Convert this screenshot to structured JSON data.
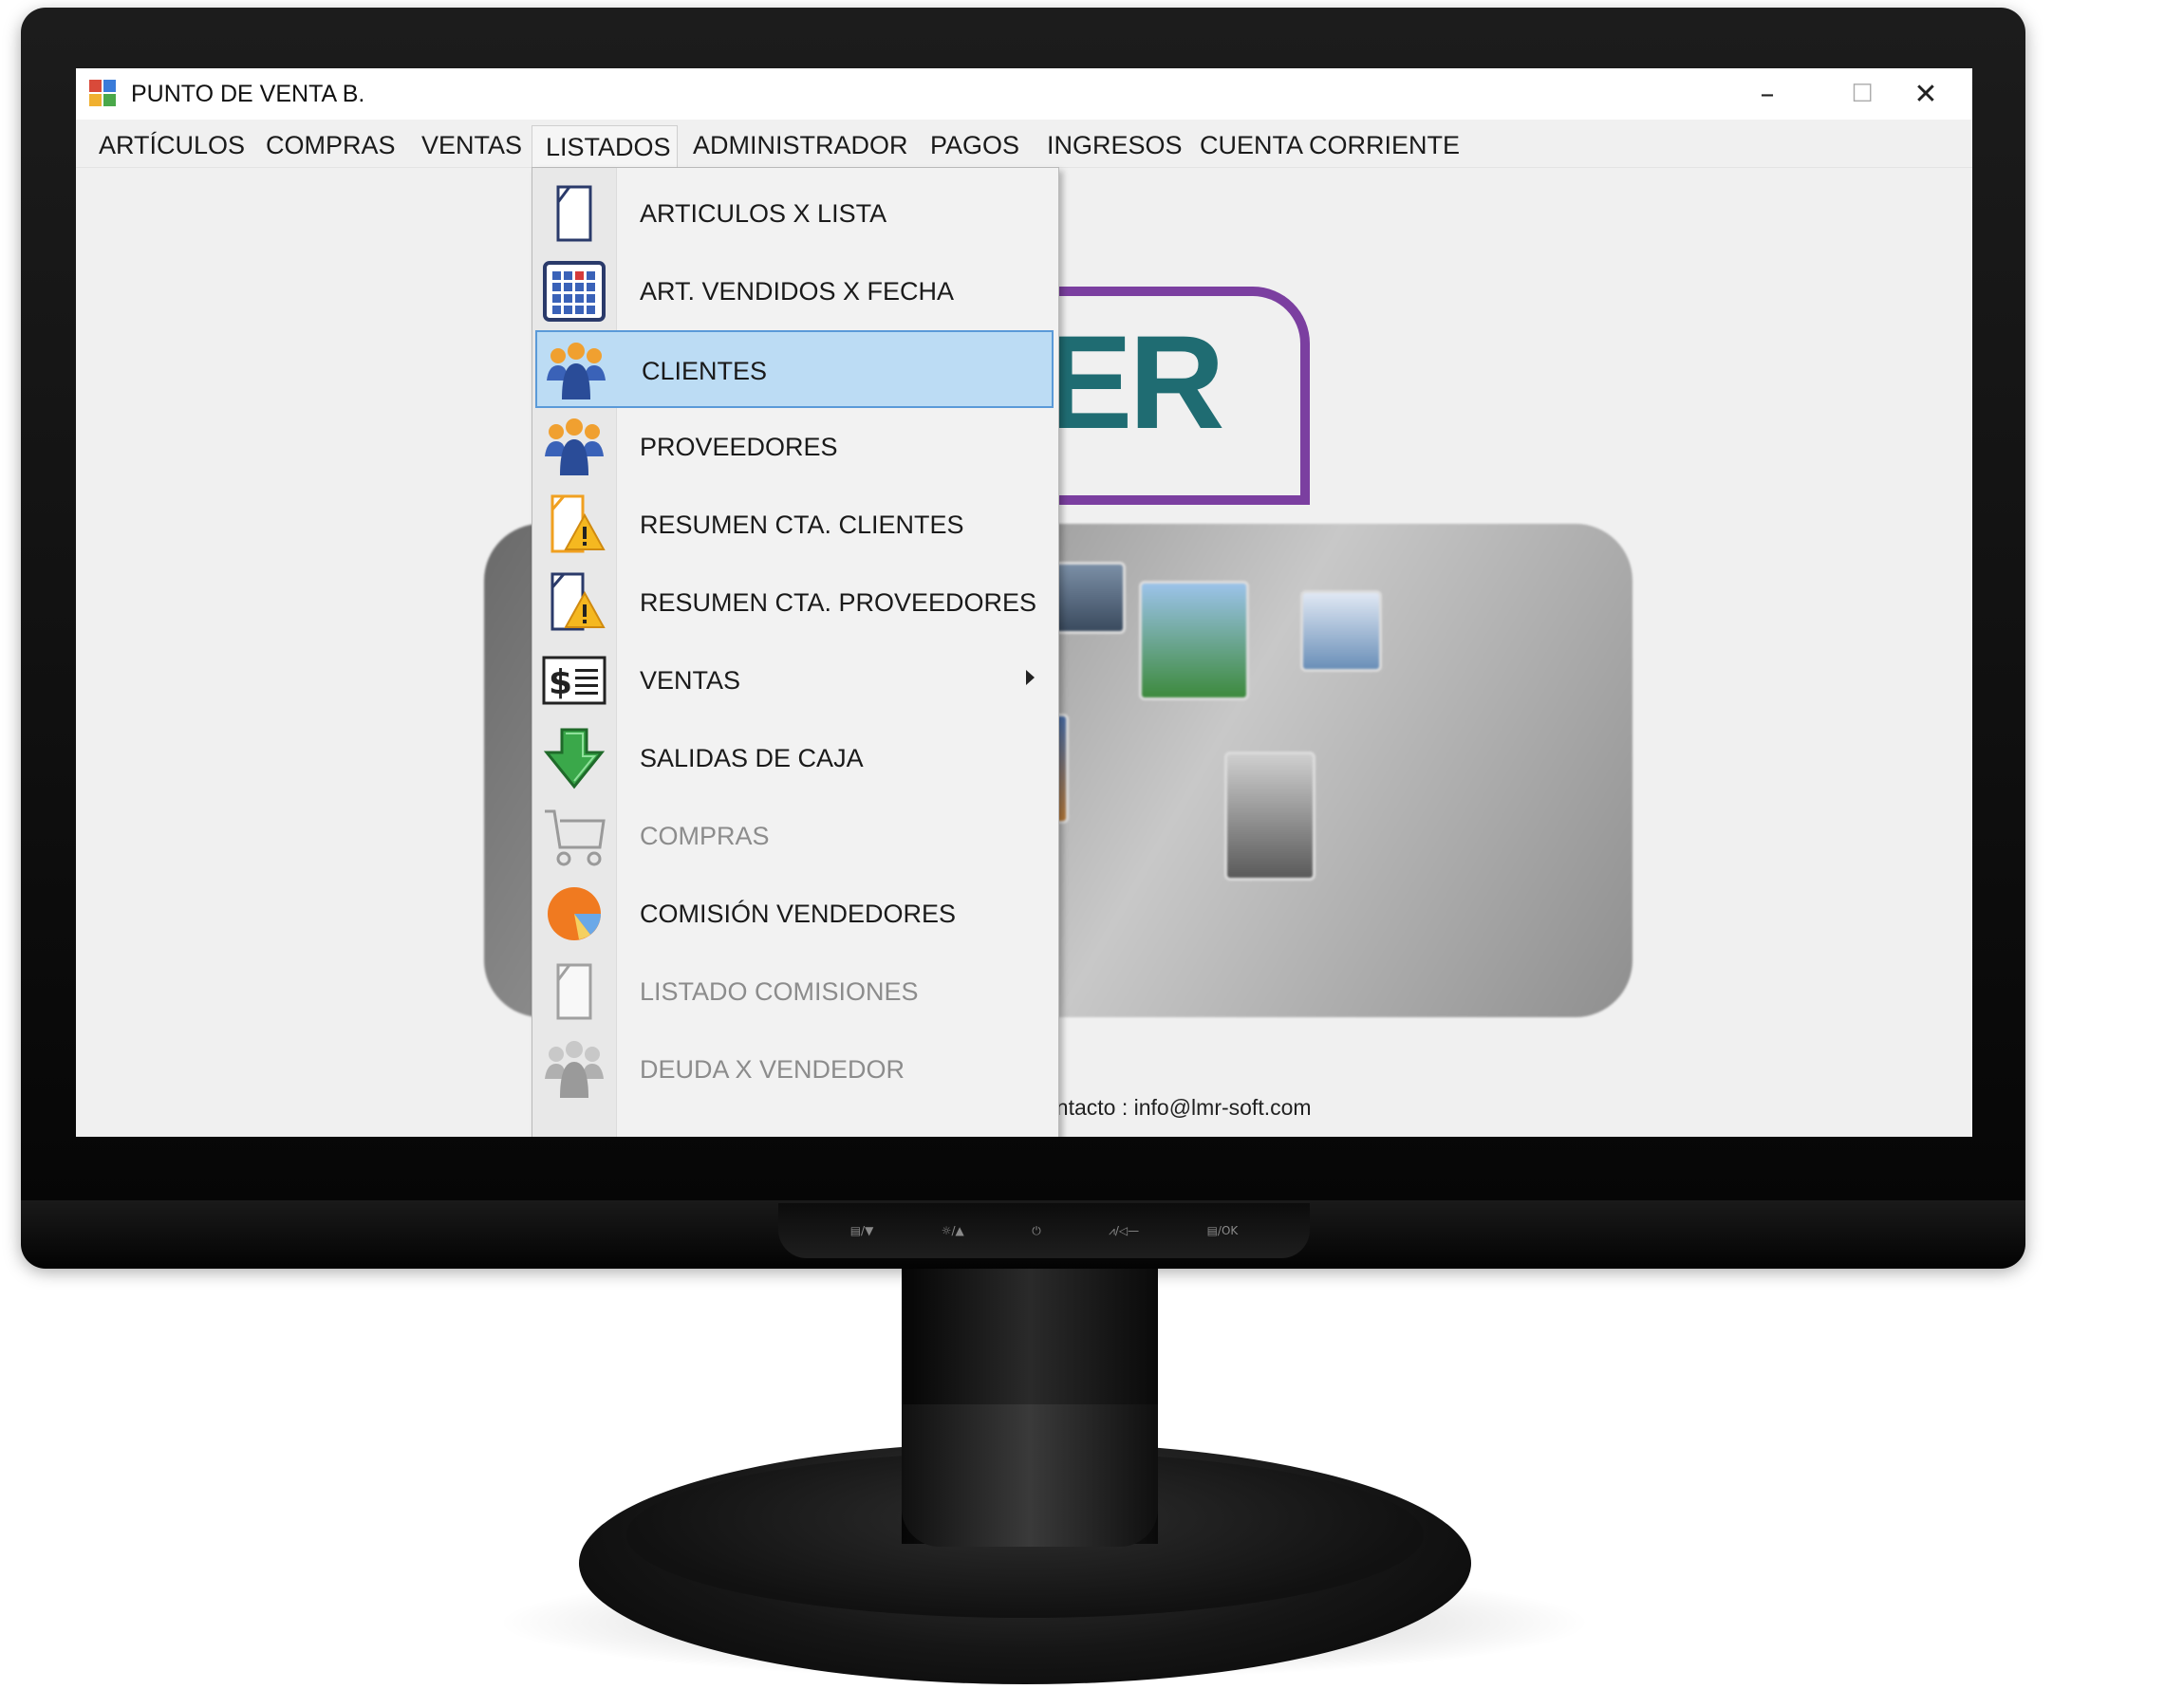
{
  "window": {
    "title": "PUNTO DE VENTA B.",
    "controls": {
      "minimize": "–",
      "maximize": "☐",
      "close": "✕"
    }
  },
  "menubar": {
    "items": [
      {
        "label": "ARTÍCULOS"
      },
      {
        "label": "COMPRAS"
      },
      {
        "label": "VENTAS"
      },
      {
        "label": "LISTADOS"
      },
      {
        "label": "ADMINISTRADOR"
      },
      {
        "label": "PAGOS"
      },
      {
        "label": "INGRESOS"
      },
      {
        "label": "CUENTA CORRIENTE"
      }
    ],
    "open_menu": "LISTADOS"
  },
  "dropdown": {
    "items": [
      {
        "label": "ARTICULOS X LISTA",
        "icon": "document-icon",
        "enabled": true
      },
      {
        "label": "ART. VENDIDOS X FECHA",
        "icon": "calendar-grid-icon",
        "enabled": true
      },
      {
        "label": "CLIENTES",
        "icon": "people-group-icon",
        "enabled": true,
        "selected": true
      },
      {
        "label": "PROVEEDORES",
        "icon": "people-group-icon",
        "enabled": true
      },
      {
        "label": "RESUMEN CTA. CLIENTES",
        "icon": "warning-document-icon",
        "enabled": true
      },
      {
        "label": "RESUMEN CTA. PROVEEDORES",
        "icon": "warning-document-icon",
        "enabled": true
      },
      {
        "label": "VENTAS",
        "icon": "dollar-list-icon",
        "enabled": true,
        "has_submenu": true
      },
      {
        "label": "SALIDAS DE CAJA",
        "icon": "down-arrow-icon",
        "enabled": true
      },
      {
        "label": "COMPRAS",
        "icon": "cart-icon",
        "enabled": false
      },
      {
        "label": "COMISIÓN VENDEDORES",
        "icon": "pie-chart-icon",
        "enabled": true
      },
      {
        "label": "LISTADO COMISIONES",
        "icon": "document-icon",
        "enabled": false
      },
      {
        "label": "DEUDA X VENDEDOR",
        "icon": "people-group-icon",
        "enabled": false
      }
    ]
  },
  "background": {
    "logo_text": "ER",
    "contact": "ontacto : info@lmr-soft.com"
  },
  "monitor": {
    "controls": [
      "▤/▼",
      "☼/▲",
      "⏻",
      "⩘/◁—",
      "▤/OK"
    ]
  },
  "colors": {
    "selection_bg": "#bcdcf4",
    "selection_border": "#5a9ad8",
    "logo_purple": "#7b3fa0",
    "logo_teal": "#1f6c72"
  }
}
